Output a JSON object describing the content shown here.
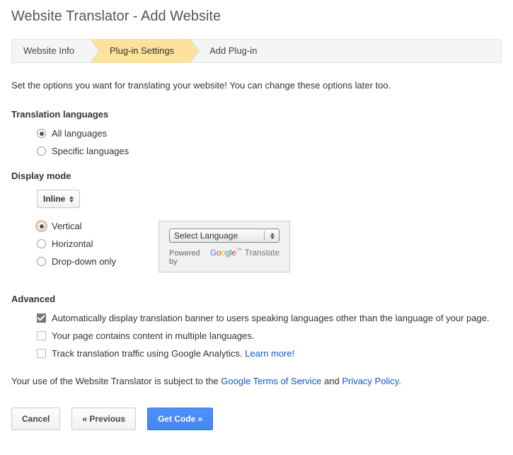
{
  "title": "Website Translator - Add Website",
  "steps": [
    {
      "label": "Website Info",
      "active": false
    },
    {
      "label": "Plug-in Settings",
      "active": true
    },
    {
      "label": "Add Plug-in",
      "active": false
    }
  ],
  "intro": "Set the options you want for translating your website! You can change these options later too.",
  "translation_languages": {
    "title": "Translation languages",
    "all": "All languages",
    "specific": "Specific languages"
  },
  "display_mode": {
    "title": "Display mode",
    "select_value": "Inline",
    "vertical": "Vertical",
    "horizontal": "Horizontal",
    "dropdown_only": "Drop-down only"
  },
  "preview": {
    "select_label": "Select Language",
    "powered": "Powered by",
    "google": {
      "g1": "G",
      "o1": "o",
      "o2": "o",
      "g2": "g",
      "l": "l",
      "e": "e"
    },
    "tm": "™",
    "translate": "Translate"
  },
  "advanced": {
    "title": "Advanced",
    "auto_banner": "Automatically display translation banner to users speaking languages other than the language of your page.",
    "multiple_lang": "Your page contains content in multiple languages.",
    "track_ga": "Track translation traffic using Google Analytics.",
    "learn_more": "Learn more!"
  },
  "footer": {
    "prefix": "Your use of the Website Translator is subject to the ",
    "tos": "Google Terms of Service",
    "and": " and ",
    "privacy": "Privacy Policy",
    "period": "."
  },
  "buttons": {
    "cancel": "Cancel",
    "previous": "« Previous",
    "get_code": "Get Code »"
  }
}
